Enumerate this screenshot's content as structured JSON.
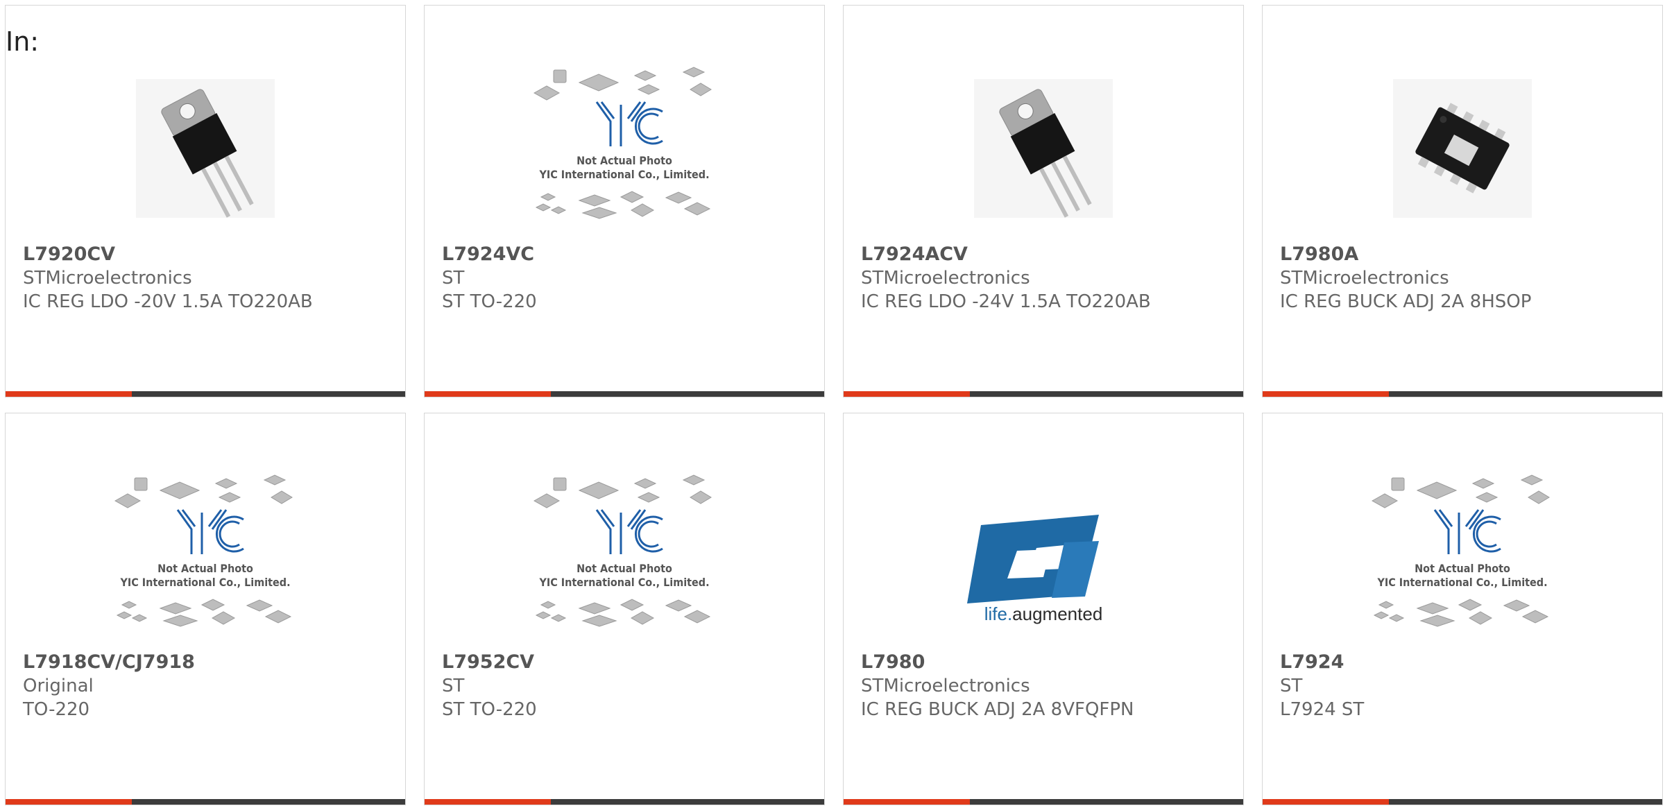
{
  "header": {
    "label": "In:"
  },
  "colors": {
    "accent": "#e03a1a",
    "bar": "#3c3c3c",
    "border": "#d6d6d6",
    "st_logo": "#1f6aa5"
  },
  "placeholder": {
    "line1": "Not Actual Photo",
    "line2": "YIC International Co., Limited.",
    "logo": "YIC"
  },
  "st_logo": {
    "text_prefix": "life.",
    "text_suffix": "augmented"
  },
  "products": [
    {
      "part": "L7920CV",
      "manufacturer": "STMicroelectronics",
      "description": "IC REG LDO -20V 1.5A TO220AB",
      "image": "to220-package-icon"
    },
    {
      "part": "L7924VC",
      "manufacturer": "ST",
      "description": "ST TO-220",
      "image": "not-actual-photo-placeholder"
    },
    {
      "part": "L7924ACV",
      "manufacturer": "STMicroelectronics",
      "description": "IC REG LDO -24V 1.5A TO220AB",
      "image": "to220-package-icon"
    },
    {
      "part": "L7980A",
      "manufacturer": "STMicroelectronics",
      "description": "IC REG BUCK ADJ 2A 8HSOP",
      "image": "hsop8-package-icon"
    },
    {
      "part": "L7918CV/CJ7918",
      "manufacturer": "Original",
      "description": "TO-220",
      "image": "not-actual-photo-placeholder"
    },
    {
      "part": "L7952CV",
      "manufacturer": "ST",
      "description": "ST TO-220",
      "image": "not-actual-photo-placeholder"
    },
    {
      "part": "L7980",
      "manufacturer": "STMicroelectronics",
      "description": "IC REG BUCK ADJ 2A 8VFQFPN",
      "image": "st-logo"
    },
    {
      "part": "L7924",
      "manufacturer": "ST",
      "description": "L7924 ST",
      "image": "not-actual-photo-placeholder"
    }
  ]
}
